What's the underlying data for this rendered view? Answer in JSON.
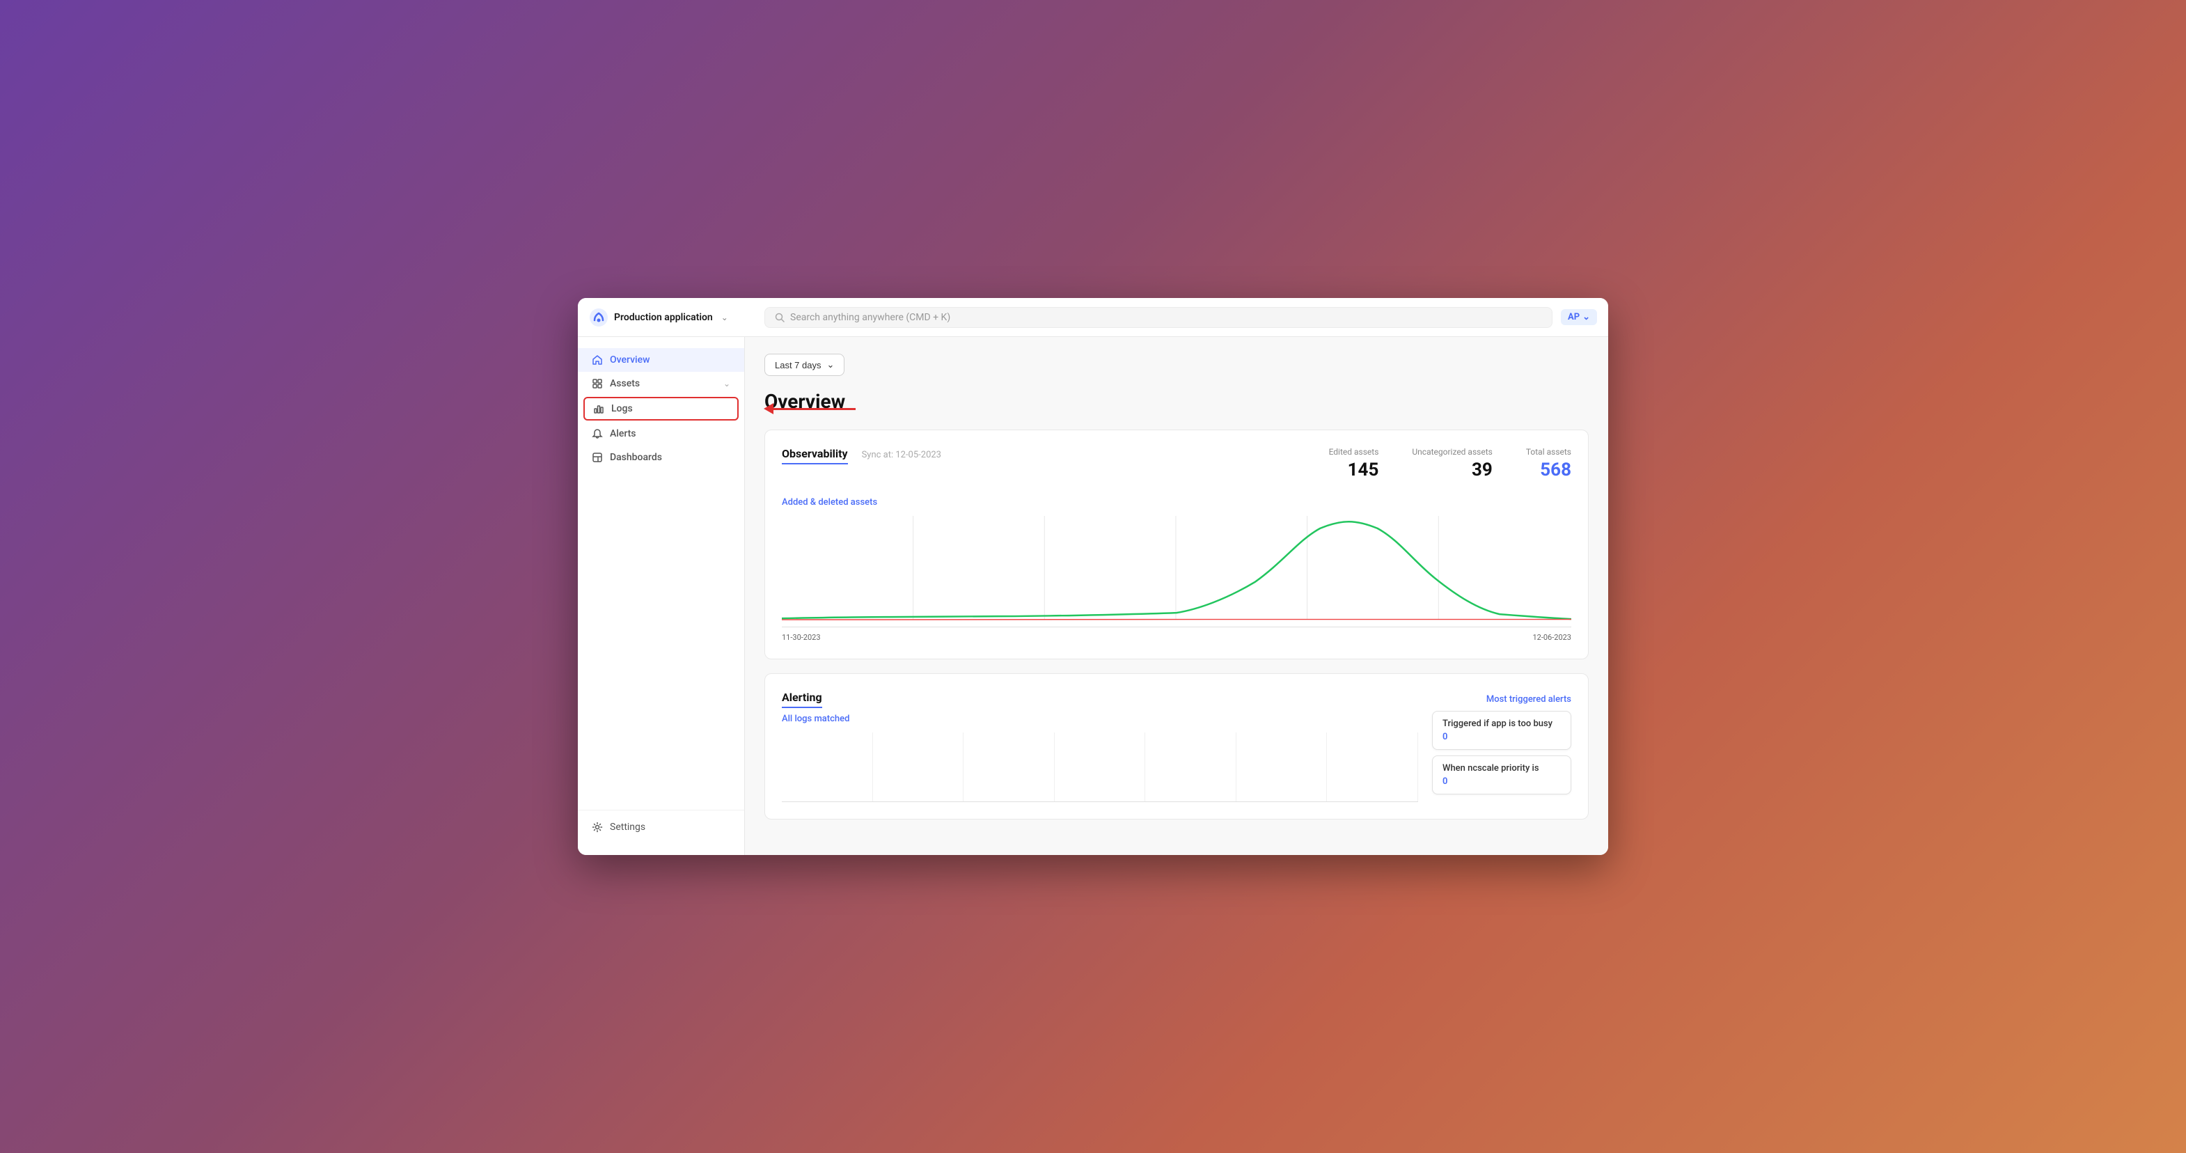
{
  "app": {
    "name": "Production application",
    "logo_color": "#4a6cf7"
  },
  "topbar": {
    "search_placeholder": "Search anything anywhere (CMD + K)",
    "user_initials": "AP"
  },
  "sidebar": {
    "items": [
      {
        "id": "overview",
        "label": "Overview",
        "active": true,
        "icon": "home-icon"
      },
      {
        "id": "assets",
        "label": "Assets",
        "active": false,
        "icon": "grid-icon",
        "has_chevron": true
      },
      {
        "id": "logs",
        "label": "Logs",
        "active": false,
        "icon": "bar-chart-icon",
        "highlighted": true
      },
      {
        "id": "alerts",
        "label": "Alerts",
        "active": false,
        "icon": "bell-icon"
      },
      {
        "id": "dashboards",
        "label": "Dashboards",
        "active": false,
        "icon": "layout-icon"
      }
    ],
    "footer": {
      "label": "Settings",
      "icon": "settings-icon"
    }
  },
  "main": {
    "date_filter": "Last 7 days",
    "page_title": "Overview",
    "observability": {
      "section_title": "Observability",
      "sync_text": "Sync at: 12-05-2023",
      "stats": [
        {
          "label": "Edited assets",
          "value": "145"
        },
        {
          "label": "Uncategorized assets",
          "value": "39"
        },
        {
          "label": "Total assets",
          "value": "568"
        }
      ],
      "chart_link": "Added & deleted assets",
      "date_start": "11-30-2023",
      "date_end": "12-06-2023"
    },
    "alerting": {
      "section_title": "Alerting",
      "chart_link": "All logs matched",
      "most_triggered_label": "Most triggered alerts",
      "alert_cards": [
        {
          "title": "Triggered if app is too busy",
          "count": "0"
        },
        {
          "title": "When ncscale priority is",
          "count": "0"
        }
      ]
    }
  }
}
